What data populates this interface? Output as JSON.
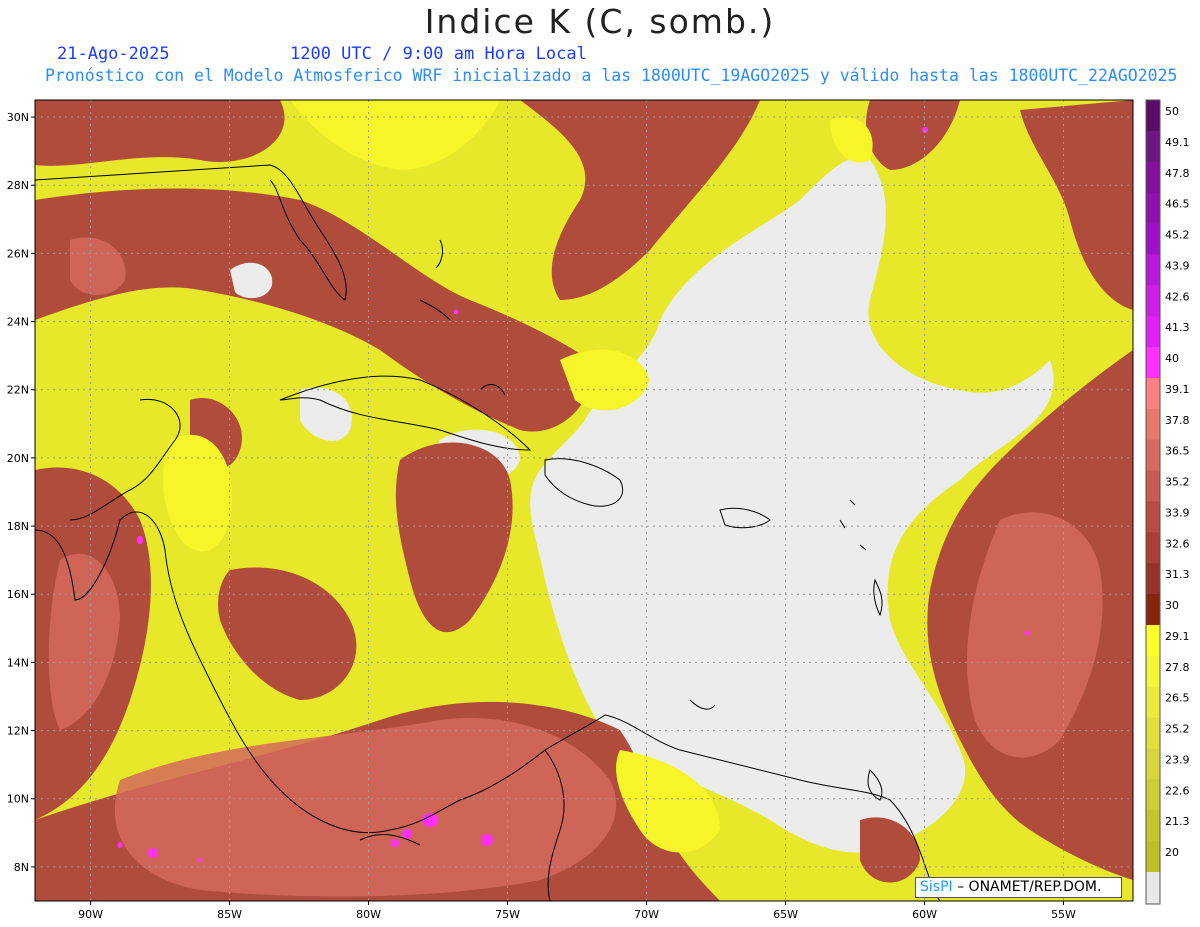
{
  "header": {
    "title": "Indice K (C, somb.)",
    "date": "21-Ago-2025",
    "time": "1200 UTC / 9:00 am Hora Local",
    "subtitle": "Pronóstico con el Modelo Atmosferico WRF inicializado a las 1800UTC_19AGO2025 y válido hasta las  1800UTC_22AGO2025"
  },
  "map": {
    "lat_range": [
      7,
      30.5
    ],
    "lon_range": [
      -92,
      -52.5
    ],
    "lat_labels": [
      "30N",
      "28N",
      "26N",
      "24N",
      "22N",
      "20N",
      "18N",
      "16N",
      "14N",
      "12N",
      "10N",
      "8N"
    ],
    "lat_values": [
      30,
      28,
      26,
      24,
      22,
      20,
      18,
      16,
      14,
      12,
      10,
      8
    ],
    "lon_labels": [
      "90W",
      "85W",
      "80W",
      "75W",
      "70W",
      "65W",
      "60W",
      "55W"
    ],
    "lon_values": [
      -90,
      -85,
      -80,
      -75,
      -70,
      -65,
      -60,
      -55
    ],
    "colors": {
      "ocean_low": "#ececec",
      "yellow": "#e8e82a",
      "yellow_bright": "#f5f52a",
      "brown": "#b04c3c",
      "brown_dark": "#8c3828",
      "salmon": "#d46a5c",
      "magenta": "#ff30ff",
      "coast": "#000000",
      "grid": "#9a9a9a"
    }
  },
  "colorbar": {
    "labels": [
      "50",
      "49.1",
      "47.8",
      "46.5",
      "45.2",
      "43.9",
      "42.6",
      "41.3",
      "40",
      "39.1",
      "37.8",
      "36.5",
      "35.2",
      "33.9",
      "32.6",
      "31.3",
      "30",
      "29.1",
      "27.8",
      "26.5",
      "25.2",
      "23.9",
      "22.6",
      "21.3",
      "20"
    ],
    "colors": [
      "#5a0c6a",
      "#6e1682",
      "#82109a",
      "#9010b0",
      "#a010c8",
      "#b818d8",
      "#cc20e8",
      "#e020f4",
      "#ff30ff",
      "#ff8080",
      "#e8786c",
      "#d86a60",
      "#c85c52",
      "#b84c42",
      "#a83e34",
      "#983226",
      "#86260e",
      "#ffff2a",
      "#f5f53a",
      "#ebeb3c",
      "#e0e03c",
      "#d6d63a",
      "#cccc34",
      "#c4c42e",
      "#bebe28"
    ],
    "bottom_color": "#e8e8e8"
  },
  "credit": {
    "logo": "SisPI",
    "text": " – ONAMET/REP.DOM."
  }
}
